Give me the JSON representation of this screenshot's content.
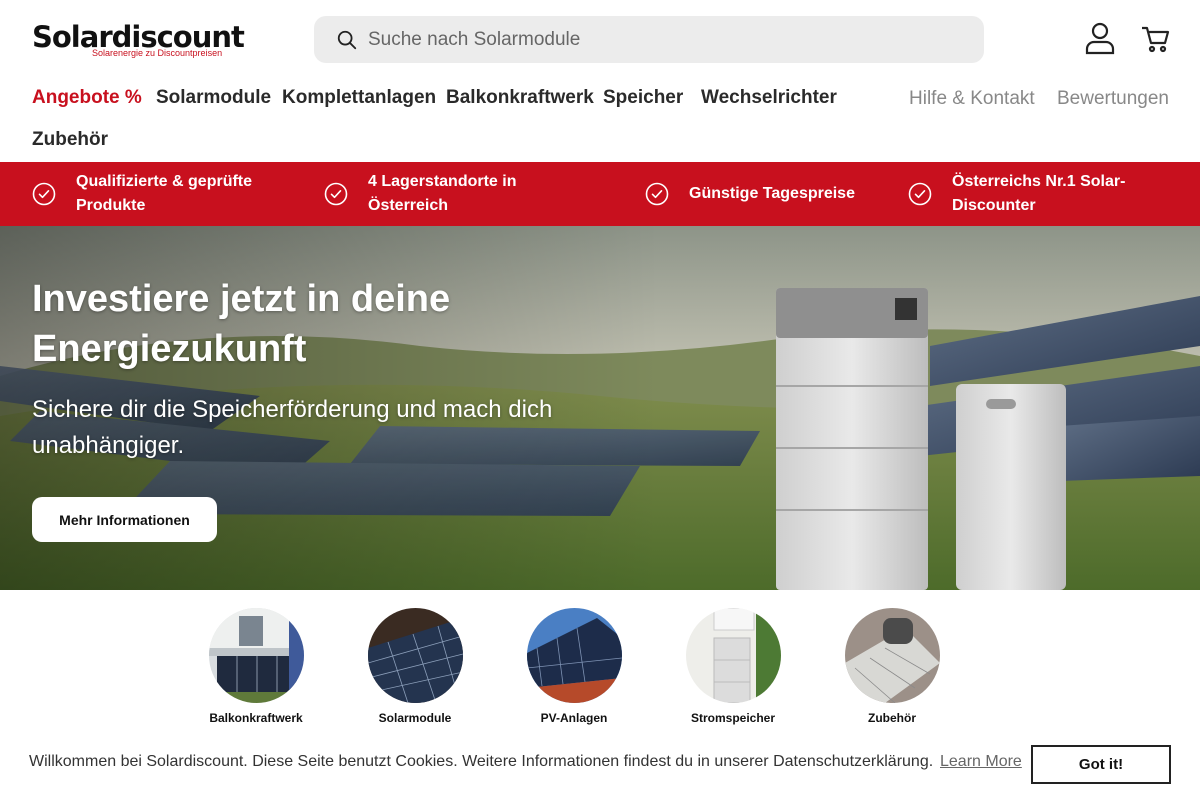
{
  "brand": {
    "name": "Solardiscount",
    "tagline": "Solarenergie zu Discountpreisen",
    "accent_color": "#c8101e"
  },
  "search": {
    "placeholder": "Suche nach Solarmodule",
    "icon": "search-icon"
  },
  "header_icons": [
    "account-icon",
    "cart-icon"
  ],
  "nav": {
    "items": [
      {
        "label": "Angebote %"
      },
      {
        "label": "Solarmodule"
      },
      {
        "label": "Komplettanlagen"
      },
      {
        "label": "Balkonkraftwerk"
      },
      {
        "label": "Speicher"
      },
      {
        "label": "Wechselrichter"
      },
      {
        "label": "Zubehör"
      }
    ],
    "secondary": [
      {
        "label": "Hilfe & Kontakt"
      },
      {
        "label": "Bewertungen"
      }
    ]
  },
  "usp": {
    "icon": "check-circle-icon",
    "items": [
      {
        "line1": "Qualifizierte & geprüfte",
        "line2": "Produkte"
      },
      {
        "line1": "4 Lagerstandorte in",
        "line2": "Österreich"
      },
      {
        "line1": "Günstige Tagespreise",
        "line2": ""
      },
      {
        "line1": "Österreichs Nr.1 Solar-",
        "line2": "Discounter"
      }
    ]
  },
  "hero": {
    "title_line1": "Investiere jetzt in deine",
    "title_line2": "Energiezukunft",
    "subtitle_line1": "Sichere dir die Speicherförderung und mach dich",
    "subtitle_line2": "unabhängiger.",
    "button_label": "Mehr Informationen"
  },
  "categories": [
    {
      "label": "Balkonkraftwerk"
    },
    {
      "label": "Solarmodule"
    },
    {
      "label": "PV-Anlagen"
    },
    {
      "label": "Stromspeicher"
    },
    {
      "label": "Zubehör"
    }
  ],
  "cookie": {
    "text": "Willkommen bei Solardiscount. Diese Seite benutzt Cookies. Weitere Informationen findest du in unserer Datenschutzerklärung.",
    "link_label": "Learn More",
    "button_label": "Got it!"
  }
}
